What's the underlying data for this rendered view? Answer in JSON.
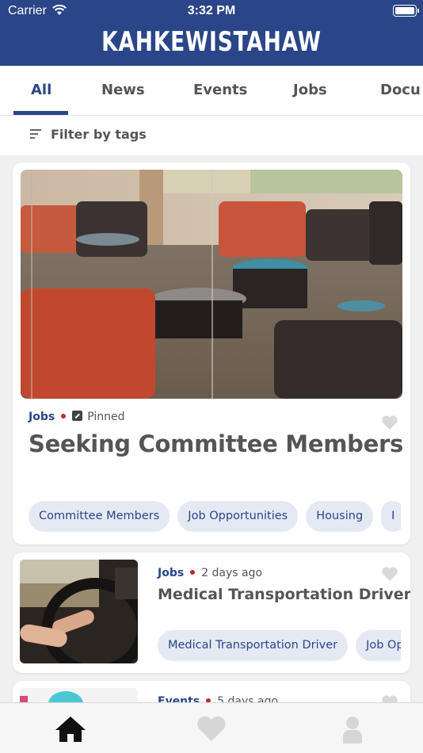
{
  "status_bar": {
    "carrier": "Carrier",
    "time": "3:32 PM"
  },
  "header": {
    "title": "KAHKEWISTAHAW"
  },
  "tabs": [
    {
      "label": "All",
      "active": true
    },
    {
      "label": "News",
      "active": false
    },
    {
      "label": "Events",
      "active": false
    },
    {
      "label": "Jobs",
      "active": false
    },
    {
      "label": "Docu",
      "active": false
    }
  ],
  "filter": {
    "label": "Filter by tags"
  },
  "posts": [
    {
      "category": "Jobs",
      "status": "Pinned",
      "title": "Seeking Committee Members",
      "tags": [
        "Committee Members",
        "Job Opportunities",
        "Housing",
        "I"
      ],
      "image": "lounge-room-photo"
    },
    {
      "category": "Jobs",
      "status": "2 days ago",
      "title": "Medical Transportation Driver",
      "tags": [
        "Medical Transportation Driver",
        "Job Op"
      ],
      "image": "steering-wheel-photo"
    },
    {
      "category": "Events",
      "status": "5 days ago",
      "title": "",
      "tags": [],
      "image": "event-photo"
    }
  ],
  "bottom_nav": [
    {
      "icon": "home-icon",
      "active": true
    },
    {
      "icon": "heart-icon",
      "active": false
    },
    {
      "icon": "profile-icon",
      "active": false
    }
  ],
  "colors": {
    "brand": "#2a4688",
    "accent_dot": "#c0272d",
    "tag_bg": "#e5e9f3"
  }
}
